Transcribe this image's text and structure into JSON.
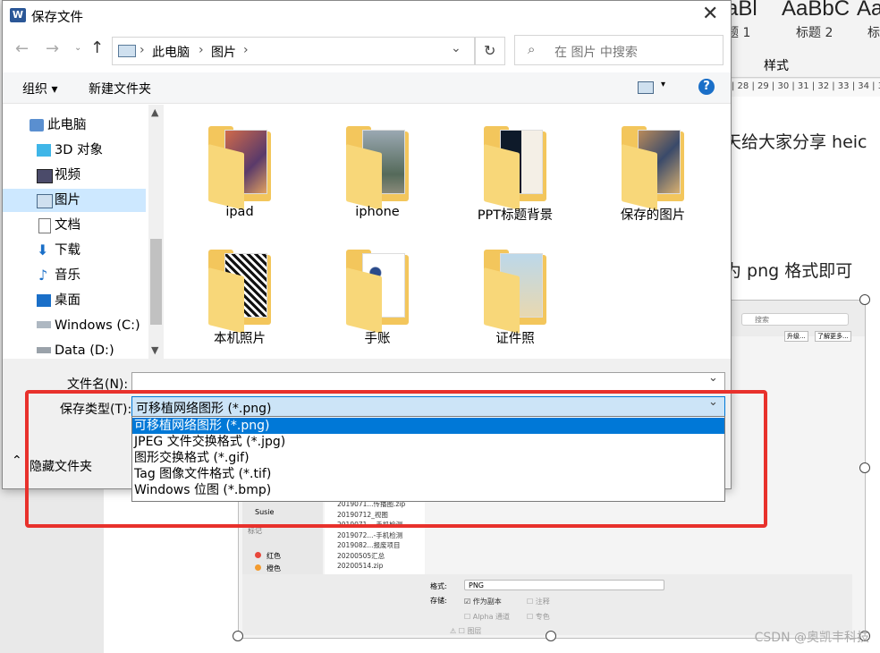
{
  "dialog": {
    "title": "保存文件",
    "nav": {
      "breadcrumb": [
        "此电脑",
        "图片"
      ],
      "search_placeholder": "在 图片 中搜索"
    },
    "toolbar": {
      "organize": "组织 ▾",
      "new_folder": "新建文件夹"
    },
    "sidebar": {
      "items": [
        "此电脑",
        "3D 对象",
        "视频",
        "图片",
        "文档",
        "下载",
        "音乐",
        "桌面",
        "Windows (C:)",
        "Data (D:)"
      ],
      "selected": "图片"
    },
    "folders": [
      {
        "name": "ipad"
      },
      {
        "name": "iphone"
      },
      {
        "name": "PPT标题背景"
      },
      {
        "name": "保存的图片"
      },
      {
        "name": "本机照片"
      },
      {
        "name": "手账"
      },
      {
        "name": "证件照"
      }
    ],
    "filename_label": "文件名(N):",
    "filename_value": "",
    "filetype_label": "保存类型(T):",
    "filetype_value": "可移植网络图形 (*.png)",
    "filetype_options": [
      "可移植网络图形 (*.png)",
      "JPEG 文件交换格式 (*.jpg)",
      "图形交换格式 (*.gif)",
      "Tag 图像文件格式 (*.tif)",
      "Windows 位图 (*.bmp)"
    ],
    "hide_folders": "隐藏文件夹"
  },
  "word": {
    "styles": [
      "aBl",
      "AaBbC",
      "Aa"
    ],
    "style_labels": [
      "题 1",
      "标题 2",
      "标"
    ],
    "styles_group": "样式",
    "ruler": "| 28 | 29 | 30 | 31 | 32 | 33 | 34 | 35 |",
    "text_line1": "天给大家分享 heic",
    "text_line2": "为 png 格式即可"
  },
  "embedded_screenshot": {
    "search": "搜索",
    "btn_upgrade": "升级...",
    "btn_more": "了解更多...",
    "sidebar": [
      "Susie",
      "标记",
      "红色",
      "橙色"
    ],
    "files": [
      "2019071...传播图.zip",
      "20190712_视图",
      "2019071...-手机检测",
      "2019072...-手机检测",
      "2019082...报废项目",
      "20200505汇总",
      "20200514.zip"
    ],
    "format_label": "格式:",
    "format_value": "PNG",
    "store_label": "存储:",
    "as_copy": "作为副本",
    "annotation": "注释",
    "alpha": "Alpha 通道",
    "spot": "专色",
    "layers": "图层"
  },
  "watermark": "CSDN @奥凯丰科技",
  "colors": {
    "highlight": "#0078d7",
    "red_box": "#e8312c",
    "folder": "#f3c65c"
  }
}
